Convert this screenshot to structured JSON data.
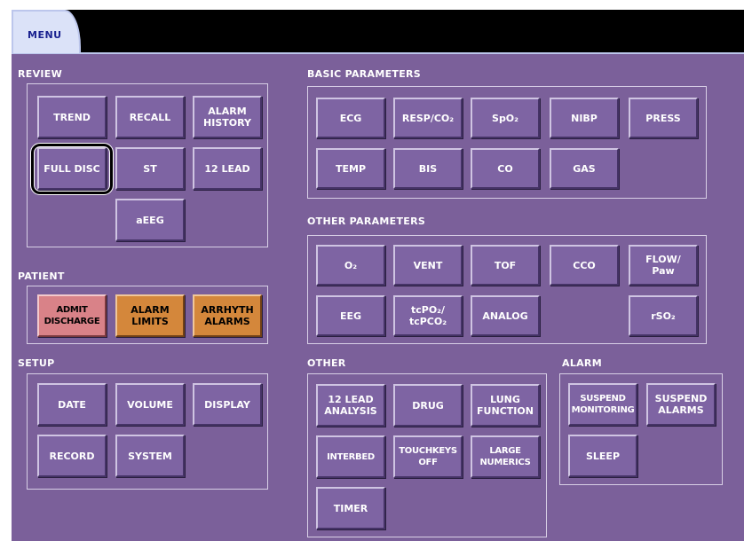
{
  "tab": {
    "label": "MENU"
  },
  "review": {
    "title": "REVIEW",
    "buttons": {
      "trend": "TREND",
      "recall": "RECALL",
      "alarm_history": "ALARM\nHISTORY",
      "full_disc": "FULL DISC",
      "st": "ST",
      "twelve_lead": "12 LEAD",
      "aeeg": "aEEG"
    }
  },
  "patient": {
    "title": "PATIENT",
    "buttons": {
      "admit_discharge": "ADMIT\nDISCHARGE",
      "alarm_limits": "ALARM\nLIMITS",
      "arrhyth_alarms": "ARRHYTH\nALARMS"
    },
    "colors": {
      "admit_discharge": "#d98288",
      "alarm_limits": "#d4873b",
      "arrhyth_alarms": "#d4873b"
    }
  },
  "setup": {
    "title": "SETUP",
    "buttons": {
      "date": "DATE",
      "volume": "VOLUME",
      "display": "DISPLAY",
      "record": "RECORD",
      "system": "SYSTEM"
    }
  },
  "basic_parameters": {
    "title": "BASIC PARAMETERS",
    "buttons": {
      "ecg": "ECG",
      "resp_co2": "RESP/CO₂",
      "spo2": "SpO₂",
      "nibp": "NIBP",
      "press": "PRESS",
      "temp": "TEMP",
      "bis": "BIS",
      "co": "CO",
      "gas": "GAS"
    }
  },
  "other_parameters": {
    "title": "OTHER PARAMETERS",
    "buttons": {
      "o2": "O₂",
      "vent": "VENT",
      "tof": "TOF",
      "cco": "CCO",
      "flow_paw": "FLOW/\nPaw",
      "eeg": "EEG",
      "tcpo2_tcpco2": "tcPO₂/\ntcPCO₂",
      "analog": "ANALOG",
      "rso2": "rSO₂"
    }
  },
  "other": {
    "title": "OTHER",
    "buttons": {
      "twelve_lead_analysis": "12 LEAD\nANALYSIS",
      "drug": "DRUG",
      "lung_function": "LUNG\nFUNCTION",
      "interbed": "INTERBED",
      "touchkeys_off": "TOUCHKEYS\nOFF",
      "large_numerics": "LARGE\nNUMERICS",
      "timer": "TIMER"
    }
  },
  "alarm": {
    "title": "ALARM",
    "buttons": {
      "suspend_monitoring": "SUSPEND\nMONITORING",
      "suspend_alarms": "SUSPEND\nALARMS",
      "sleep": "SLEEP"
    }
  },
  "colors": {
    "panel": "#7b609a",
    "button": "#7e64a3",
    "topbar": "#000000",
    "tab": "#dbe2f8"
  },
  "selected_button": "full_disc"
}
